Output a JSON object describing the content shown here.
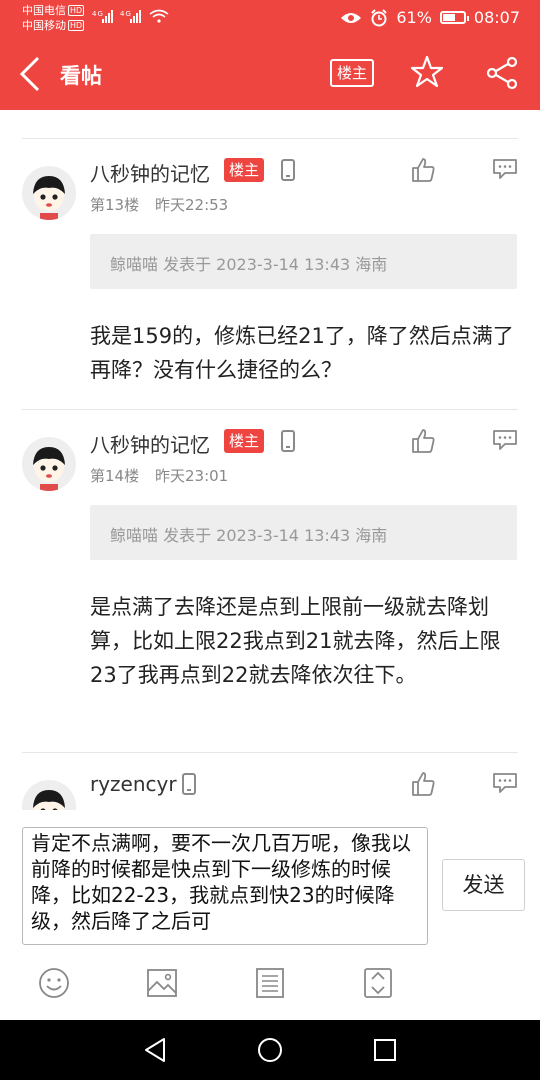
{
  "status": {
    "carrier1": "中国电信",
    "carrier2": "中国移动",
    "hd": "HD",
    "net": "4G",
    "battery_pct": "61%",
    "battery_level": 0.61,
    "time": "08:07"
  },
  "header": {
    "back_icon": "chevron-left-icon",
    "title": "看帖",
    "lz_button": "楼主",
    "star_icon": "star-icon",
    "share_icon": "share-icon"
  },
  "posts": [
    {
      "username": "八秒钟的记忆",
      "badge": "楼主",
      "floor": "第13楼",
      "time": "昨天22:53",
      "quote": "鲸喵喵 发表于 2023-3-14 13:43 海南",
      "text": "我是159的，修炼已经21了，降了然后点满了再降？没有什么捷径的么？"
    },
    {
      "username": "八秒钟的记忆",
      "badge": "楼主",
      "floor": "第14楼",
      "time": "昨天23:01",
      "quote": "鲸喵喵 发表于 2023-3-14 13:43 海南",
      "text": "是点满了去降还是点到上限前一级就去降划算，比如上限22我点到21就去降，然后上限23了我再点到22就去降依次往下。"
    },
    {
      "username": "ryzencyr",
      "floor": "",
      "time": ""
    }
  ],
  "composer": {
    "input_value": "肯定不点满啊，要不一次几百万呢，像我以前降的时候都是快点到下一级修炼的时候降，比如22-23，我就点到快23的时候降级，然后降了之后可",
    "send_label": "发送",
    "tools": [
      "emoji-icon",
      "image-icon",
      "list-icon",
      "expand-icon"
    ]
  },
  "colors": {
    "brand": "#ee4540",
    "quote_bg": "#eeeeee",
    "meta": "#888888"
  }
}
